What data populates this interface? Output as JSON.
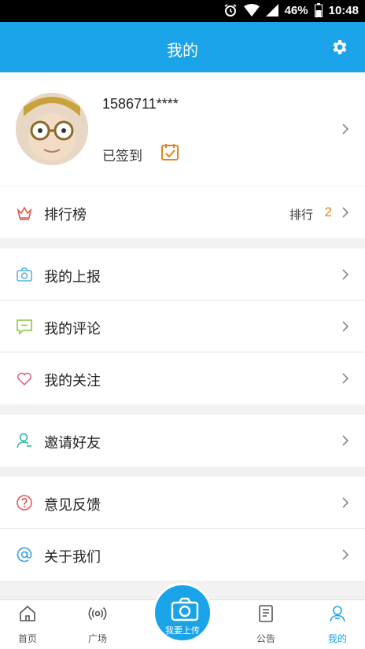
{
  "status_bar": {
    "battery": "46%",
    "time": "10:48"
  },
  "header": {
    "title": "我的"
  },
  "profile": {
    "phone": "1586711****",
    "signed_label": "已签到"
  },
  "rank": {
    "label": "排行榜",
    "rank_text": "排行",
    "rank_value": "2"
  },
  "menu": {
    "my_reports": "我的上报",
    "my_comments": "我的评论",
    "my_follows": "我的关注",
    "invite_friends": "邀请好友",
    "feedback": "意见反馈",
    "about_us": "关于我们"
  },
  "tabbar": {
    "home": "首页",
    "plaza": "广场",
    "upload": "我要上传",
    "notice": "公告",
    "mine": "我的"
  },
  "colors": {
    "primary": "#1aa3e8",
    "accent": "#e6821e"
  }
}
